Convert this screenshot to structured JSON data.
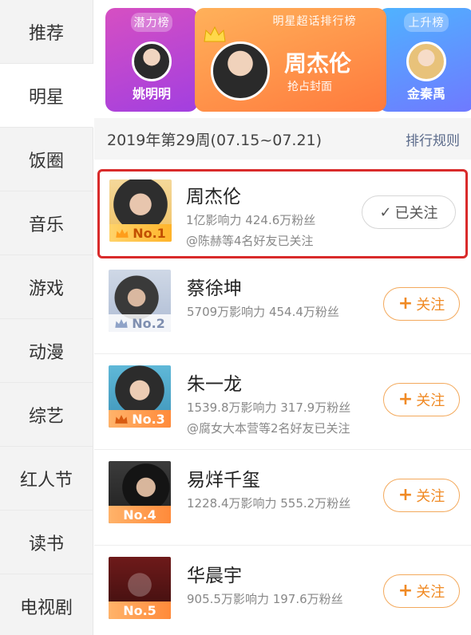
{
  "sidebar": {
    "items": [
      {
        "label": "推荐"
      },
      {
        "label": "明星"
      },
      {
        "label": "饭圈"
      },
      {
        "label": "音乐"
      },
      {
        "label": "游戏"
      },
      {
        "label": "动漫"
      },
      {
        "label": "综艺"
      },
      {
        "label": "红人节"
      },
      {
        "label": "读书"
      },
      {
        "label": "电视剧"
      }
    ],
    "active_index": 1
  },
  "banner": {
    "left": {
      "tag": "潜力榜",
      "name": "姚明明"
    },
    "center": {
      "tag": "明星超话排行榜",
      "name": "周杰伦",
      "subtitle": "抢占封面"
    },
    "right": {
      "tag": "上升榜",
      "name": "金秦禹"
    }
  },
  "period": {
    "label": "2019年第29周(07.15~07.21)",
    "rules_link": "排行规则"
  },
  "list": [
    {
      "rank": "No.1",
      "name": "周杰伦",
      "stats": "1亿影响力 424.6万粉丝",
      "friends": "@陈赫等4名好友已关注",
      "button": "已关注",
      "followed": true
    },
    {
      "rank": "No.2",
      "name": "蔡徐坤",
      "stats": "5709万影响力 454.4万粉丝",
      "friends": "",
      "button": "关注",
      "followed": false
    },
    {
      "rank": "No.3",
      "name": "朱一龙",
      "stats": "1539.8万影响力 317.9万粉丝",
      "friends": "@腐女大本营等2名好友已关注",
      "button": "关注",
      "followed": false
    },
    {
      "rank": "No.4",
      "name": "易烊千玺",
      "stats": "1228.4万影响力 555.2万粉丝",
      "friends": "",
      "button": "关注",
      "followed": false
    },
    {
      "rank": "No.5",
      "name": "华晨宇",
      "stats": "905.5万影响力 197.6万粉丝",
      "friends": "",
      "button": "关注",
      "followed": false
    }
  ],
  "colors": {
    "accent_orange": "#f08a24",
    "highlight_red": "#d92b2b",
    "link_blue": "#5a6a8a"
  }
}
